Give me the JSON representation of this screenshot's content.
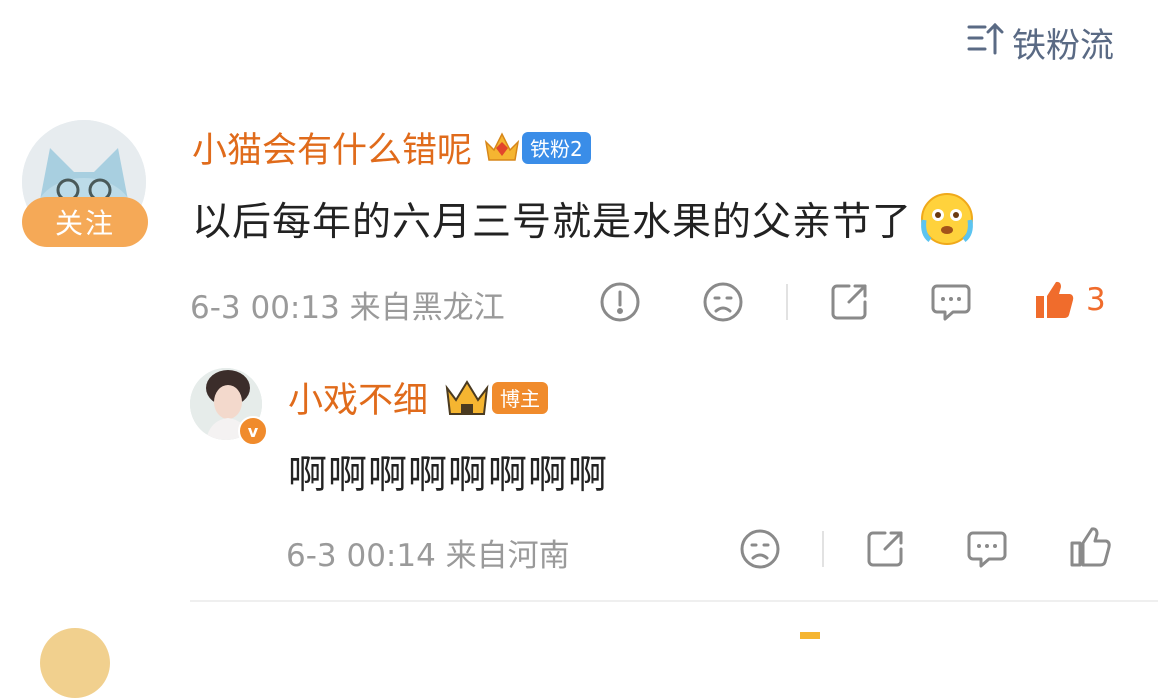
{
  "header": {
    "sort_label": "铁粉流",
    "sort_icon": "sort-icon"
  },
  "comments": [
    {
      "user": "小猫会有什么错呢",
      "badge_label": "铁粉2",
      "badge_color": "#3a8de8",
      "follow_label": "关注",
      "content": "以后每年的六月三号就是水果的父亲节了",
      "emoji": "cry-face-emoji",
      "meta": "6-3 00:13 来自黑龙江",
      "like_count": "3",
      "like_color": "#f06c2c"
    },
    {
      "user": "小戏不细",
      "badge_label": "博主",
      "badge_color": "#f08b2c",
      "content": "啊啊啊啊啊啊啊啊",
      "meta": "6-3 00:14 来自河南"
    }
  ]
}
